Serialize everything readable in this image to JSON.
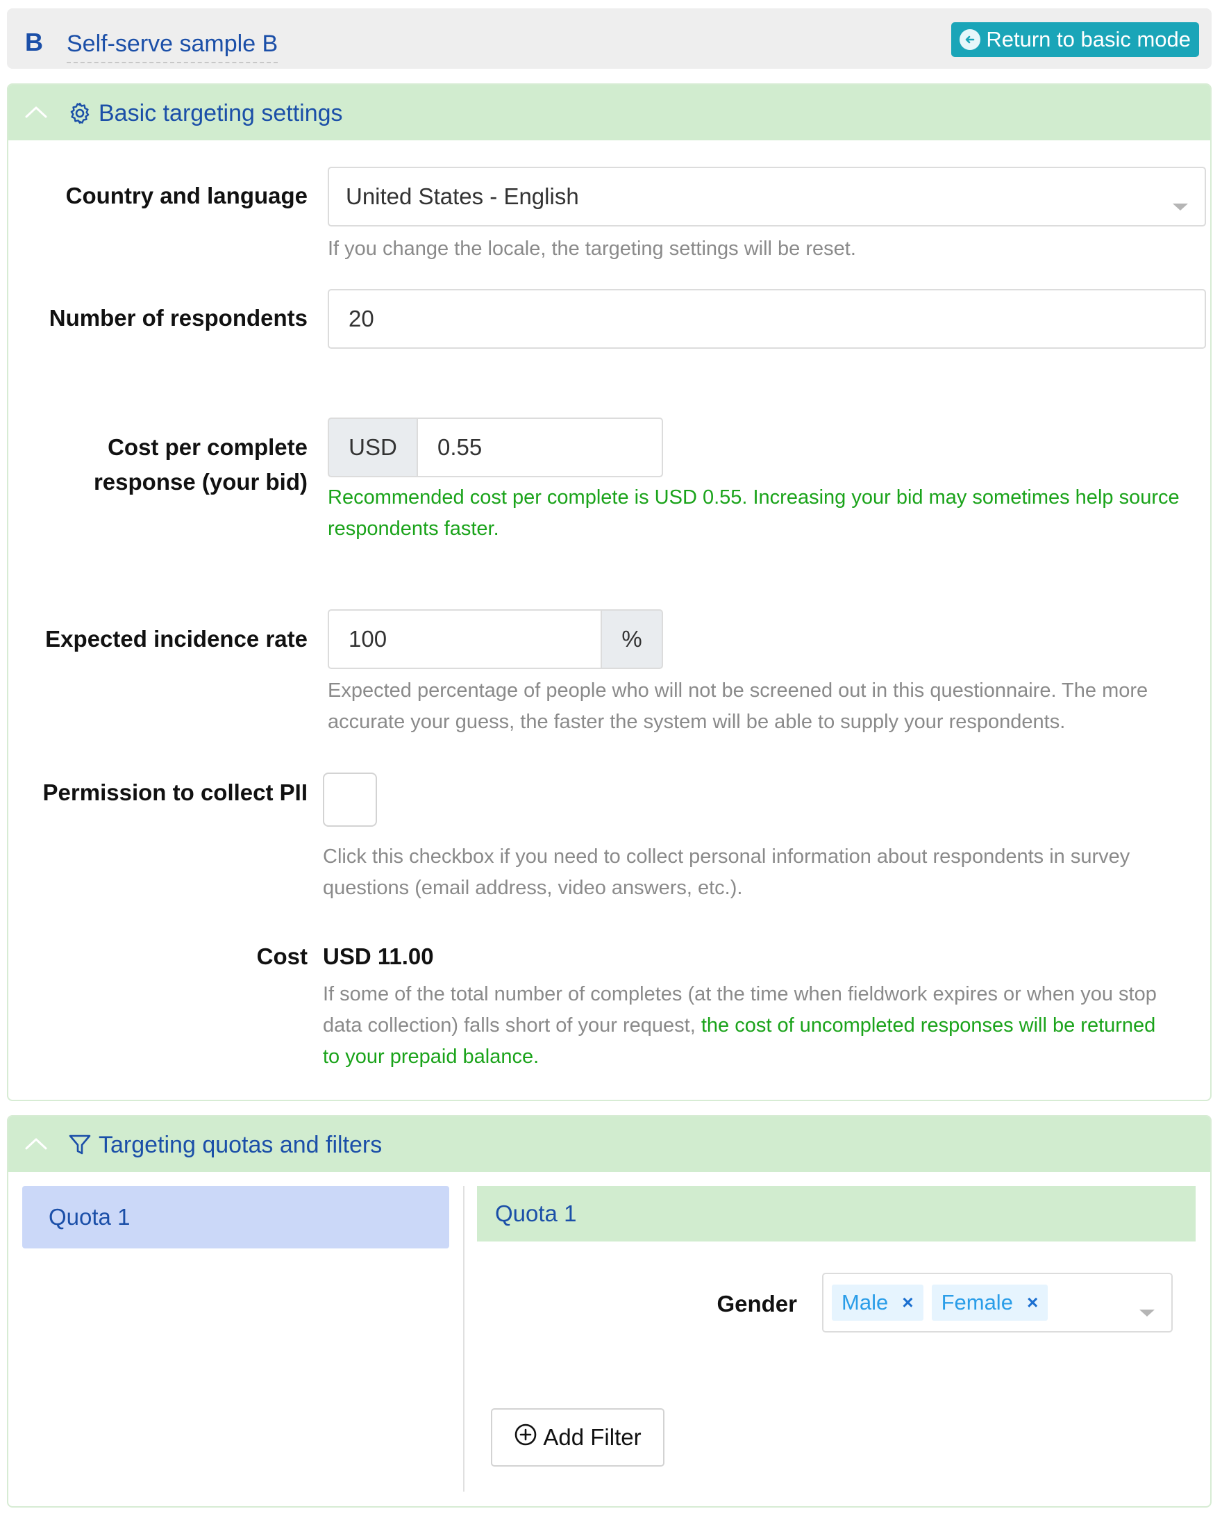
{
  "header": {
    "badge": "B",
    "title": "Self-serve sample B",
    "return_button": "Return to basic mode"
  },
  "basic": {
    "section_title": "Basic targeting settings",
    "country": {
      "label": "Country and language",
      "value": "United States - English",
      "help": "If you change the locale, the targeting settings will be reset."
    },
    "respondents": {
      "label": "Number of respondents",
      "value": "20"
    },
    "cpc": {
      "label_line1": "Cost per complete",
      "label_line2": "response (your bid)",
      "currency": "USD",
      "value": "0.55",
      "help_line1": "Recommended cost per complete is USD 0.55. Increasing your bid may sometimes help source",
      "help_line2": "respondents faster."
    },
    "incidence": {
      "label": "Expected incidence rate",
      "value": "100",
      "unit": "%",
      "help_line1": "Expected percentage of people who will not be screened out in this questionnaire. The more",
      "help_line2": "accurate your guess, the faster the system will be able to supply your respondents."
    },
    "pii": {
      "label": "Permission to collect PII",
      "help_line1": "Click this checkbox if you need to collect personal information about respondents in survey",
      "help_line2": "questions (email address, video answers, etc.)."
    },
    "cost": {
      "label": "Cost",
      "value": "USD 11.00",
      "help_line1": "If some of the total number of completes (at the time when fieldwork expires or when you stop",
      "help_line2_gray": "data collection) falls short of your request, ",
      "help_line2_green": "the cost of uncompleted responses will be returned",
      "help_line3_green": "to your prepaid balance."
    }
  },
  "quotas": {
    "section_title": "Targeting quotas and filters",
    "list": [
      {
        "label": "Quota 1"
      }
    ],
    "detail_title": "Quota 1",
    "gender": {
      "label": "Gender",
      "tags": [
        "Male",
        "Female"
      ]
    },
    "add_filter": "Add Filter"
  },
  "colors": {
    "accent_blue": "#1b4fa8",
    "teal_button": "#1aa5b8",
    "panel_green": "#d1eccf",
    "help_green": "#1aa31a"
  }
}
